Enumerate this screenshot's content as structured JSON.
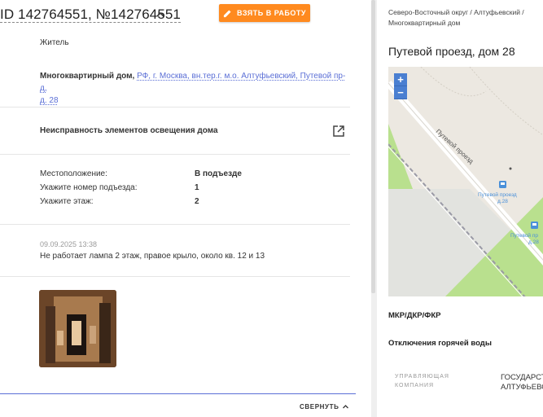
{
  "ticket": {
    "id_text": "ID 142764551, №142764551",
    "take_button": "ВЗЯТЬ В РАБОТУ",
    "applicant_role": "Житель",
    "address_type": "Многоквартирный дом,",
    "address_link": "РФ, г. Москва, вн.тер.г. м.о. Алтуфьевский, Путевой пр-д,",
    "address_link_2": "д. 28",
    "problem": "Неисправность элементов освещения дома",
    "fields": [
      {
        "label": "Местоположение:",
        "value": "В подъезде"
      },
      {
        "label": "Укажите номер подъезда:",
        "value": "1"
      },
      {
        "label": "Укажите этаж:",
        "value": "2"
      }
    ],
    "comment_date": "09.09.2025 13:38",
    "comment_text": "Не работает лампа 2 этаж, правое крыло, около кв. 12 и 13",
    "collapse_label": "СВЕРНУТЬ"
  },
  "side": {
    "breadcrumbs_line1": "Северо-Восточный округ / Алтуфьевский /",
    "breadcrumbs_line2": "Многоквартирный дом",
    "title": "Путевой проезд, дом 28",
    "map": {
      "zoom_in": "+",
      "zoom_out": "−",
      "street_label": "Путевой проезд",
      "stop1_line1": "Путевой проезд",
      "stop1_line2": "д.28",
      "stop2_line1": "Путевой пр",
      "stop2_line2": "д.28"
    },
    "section1": "МКР/ДКР/ФКР",
    "section2": "Отключения горячей воды",
    "table_header_line1": "УПРАВЛЯЮЩАЯ",
    "table_header_line2": "КОМПАНИЯ",
    "table_value_line1": "ГОСУДАРСТ",
    "table_value_line2": "АЛТУФЬЕВС"
  },
  "colors": {
    "accent": "#5b6fd6",
    "action": "#ff8a1f",
    "map_zoom": "#4a7fd1",
    "map_park": "#b7e08a"
  },
  "icons": [
    "chevron-up-icon",
    "pencil-icon",
    "open-external-icon",
    "bus-stop-icon"
  ]
}
